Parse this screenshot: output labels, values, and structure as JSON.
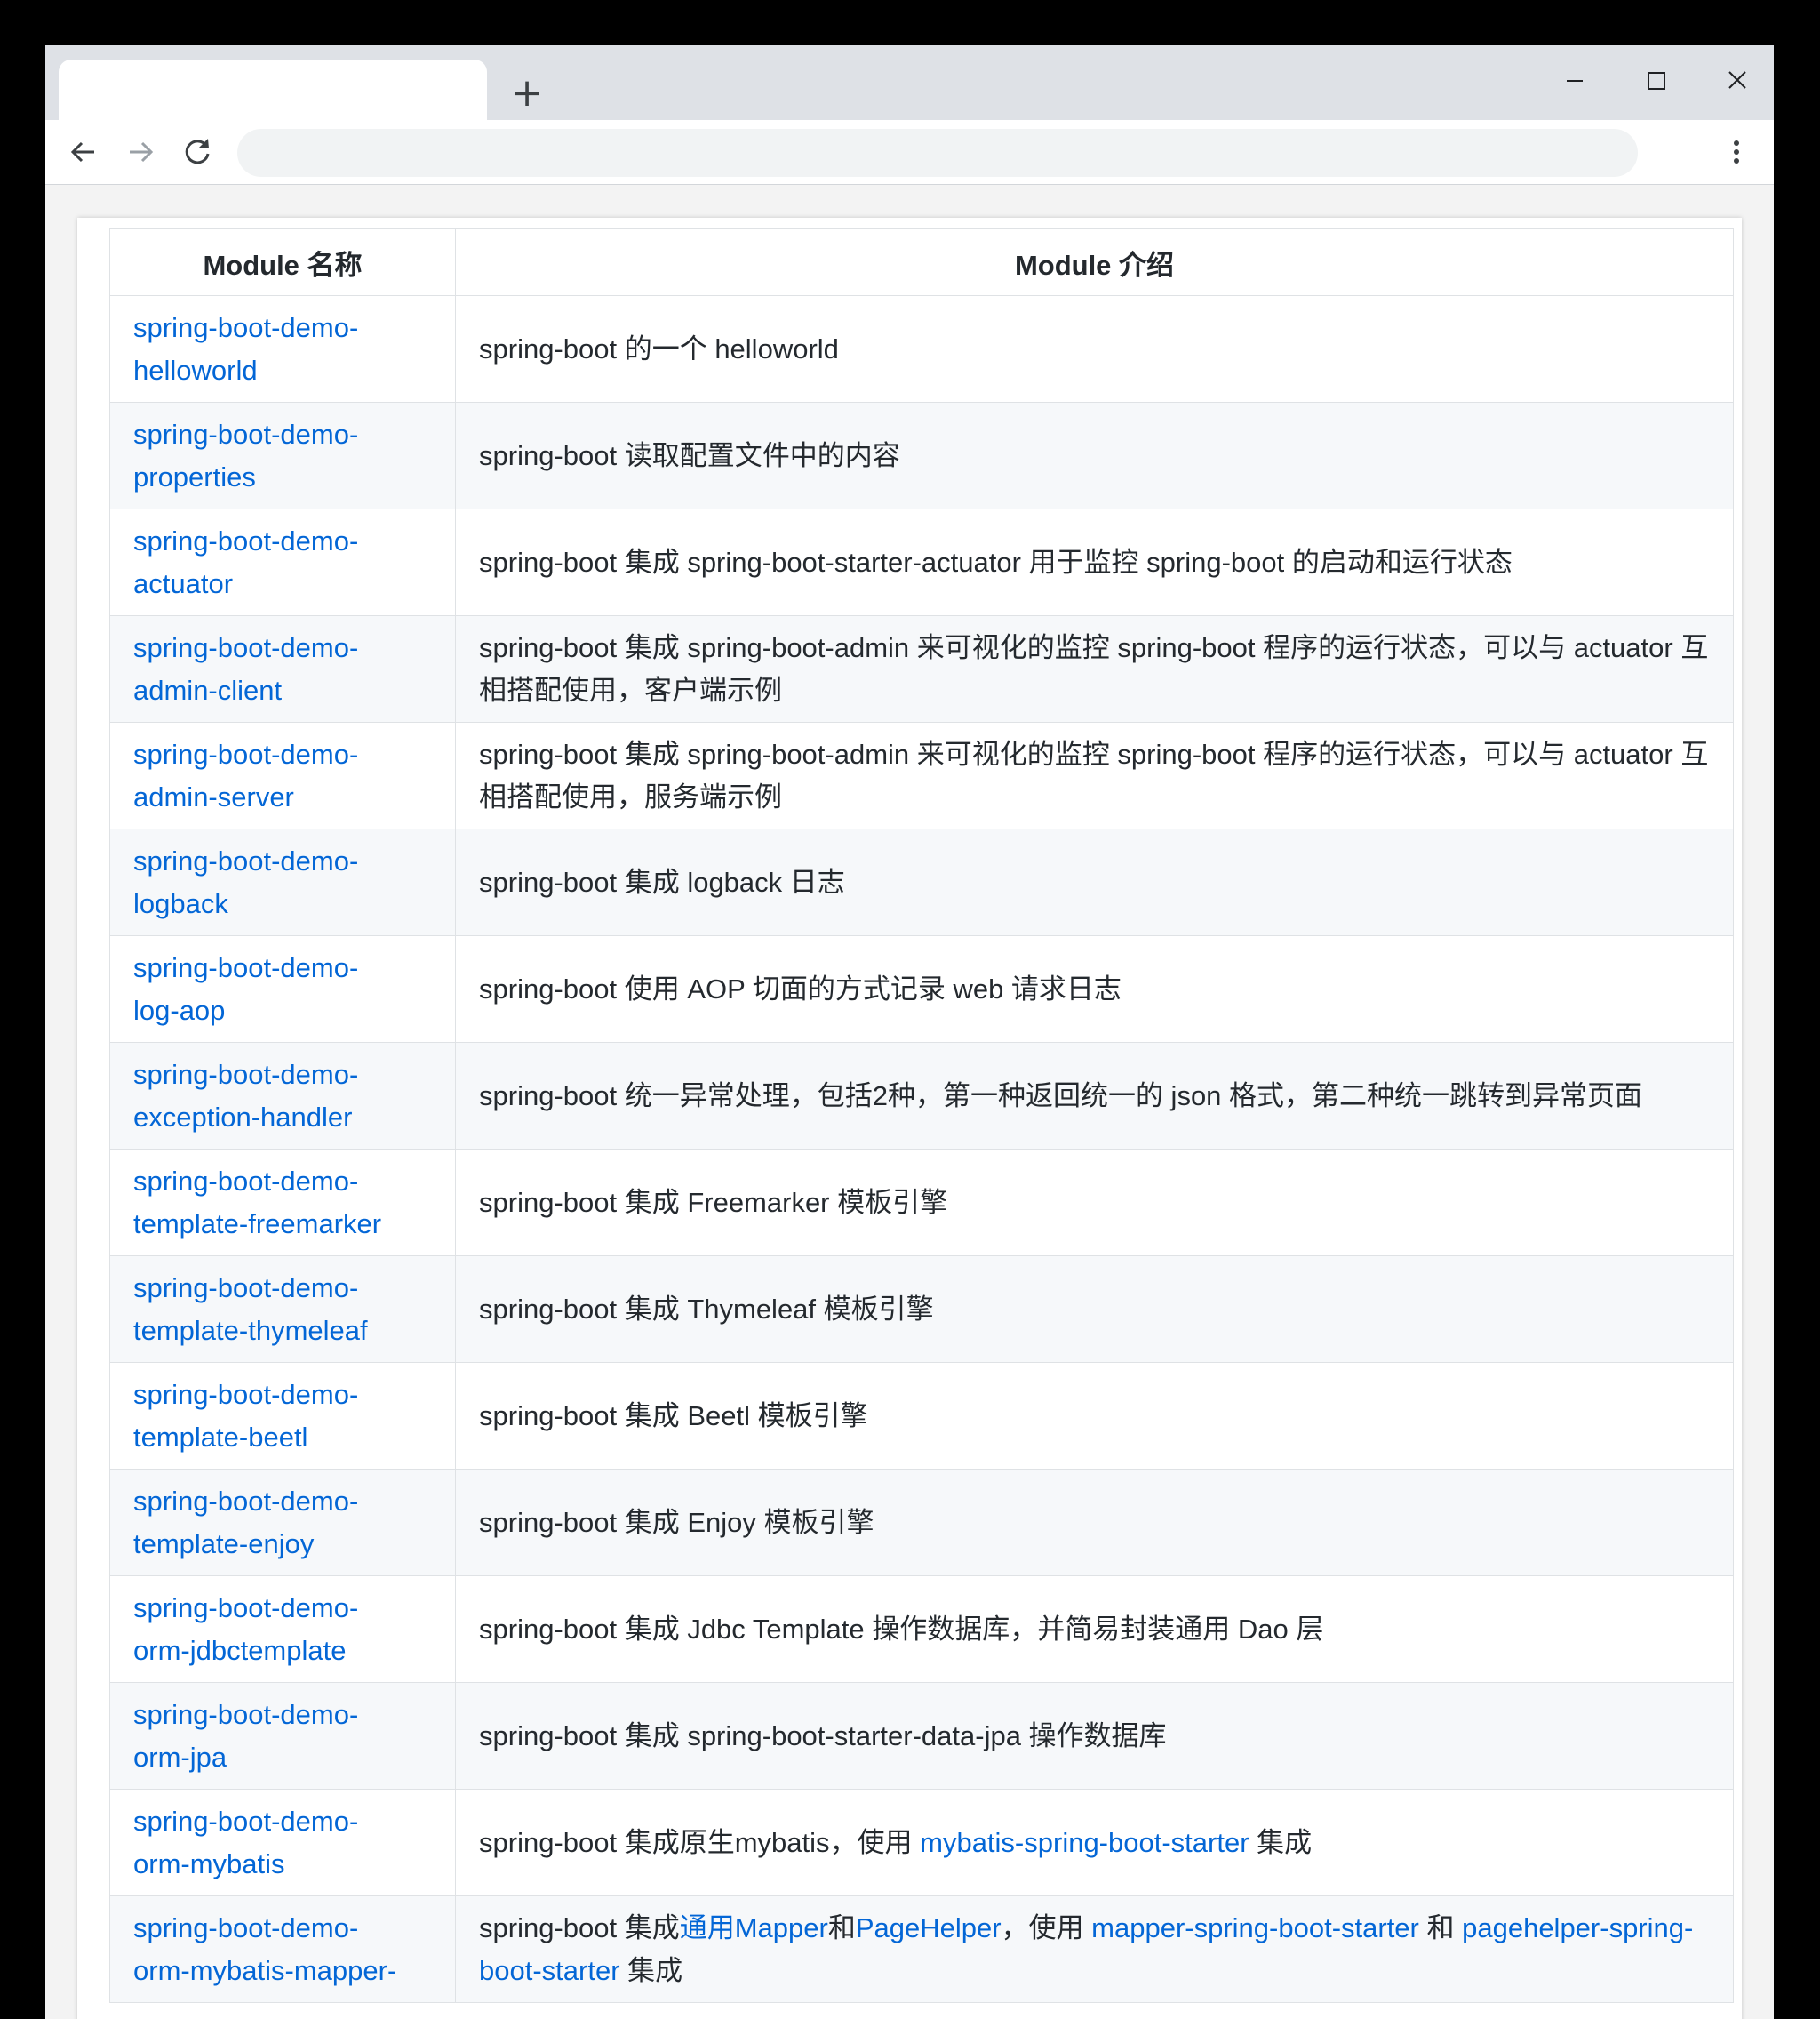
{
  "browser": {
    "tab_title": "",
    "new_tab_label": "+",
    "address_value": "",
    "icons": {
      "back": "arrow-left-icon",
      "forward": "arrow-right-icon",
      "reload": "reload-icon",
      "menu": "kebab-menu-icon",
      "minimize": "minimize-icon",
      "maximize": "maximize-icon",
      "close": "close-icon"
    }
  },
  "table": {
    "headers": [
      "Module 名称",
      "Module 介绍"
    ],
    "rows": [
      {
        "name": "spring-boot-demo-helloworld",
        "name_l1": "spring-boot-demo-",
        "name_l2": "helloworld",
        "desc": [
          {
            "t": "spring-boot 的一个 helloworld"
          }
        ]
      },
      {
        "name": "spring-boot-demo-properties",
        "name_l1": "spring-boot-demo-",
        "name_l2": "properties",
        "desc": [
          {
            "t": "spring-boot 读取配置文件中的内容"
          }
        ]
      },
      {
        "name": "spring-boot-demo-actuator",
        "name_l1": "spring-boot-demo-",
        "name_l2": "actuator",
        "desc": [
          {
            "t": "spring-boot 集成 spring-boot-starter-actuator 用于监控 spring-boot 的启动和运行状态"
          }
        ]
      },
      {
        "name": "spring-boot-demo-admin-client",
        "name_l1": "spring-boot-demo-",
        "name_l2": "admin-client",
        "desc": [
          {
            "t": "spring-boot 集成 spring-boot-admin 来可视化的监控 spring-boot 程序的运行状态，可以与 actuator 互相搭配使用，客户端示例"
          }
        ]
      },
      {
        "name": "spring-boot-demo-admin-server",
        "name_l1": "spring-boot-demo-",
        "name_l2": "admin-server",
        "desc": [
          {
            "t": "spring-boot 集成 spring-boot-admin 来可视化的监控 spring-boot 程序的运行状态，可以与 actuator 互相搭配使用，服务端示例"
          }
        ]
      },
      {
        "name": "spring-boot-demo-logback",
        "name_l1": "spring-boot-demo-",
        "name_l2": "logback",
        "desc": [
          {
            "t": "spring-boot 集成 logback 日志"
          }
        ]
      },
      {
        "name": "spring-boot-demo-log-aop",
        "name_l1": "spring-boot-demo-",
        "name_l2": "log-aop",
        "desc": [
          {
            "t": "spring-boot 使用 AOP 切面的方式记录 web 请求日志"
          }
        ]
      },
      {
        "name": "spring-boot-demo-exception-handler",
        "name_l1": "spring-boot-demo-",
        "name_l2": "exception-handler",
        "desc": [
          {
            "t": "spring-boot 统一异常处理，包括2种，第一种返回统一的 json 格式，第二种统一跳转到异常页面"
          }
        ]
      },
      {
        "name": "spring-boot-demo-template-freemarker",
        "name_l1": "spring-boot-demo-",
        "name_l2": "template-freemarker",
        "desc": [
          {
            "t": "spring-boot 集成 Freemarker 模板引擎"
          }
        ]
      },
      {
        "name": "spring-boot-demo-template-thymeleaf",
        "name_l1": "spring-boot-demo-",
        "name_l2": "template-thymeleaf",
        "desc": [
          {
            "t": "spring-boot 集成 Thymeleaf 模板引擎"
          }
        ]
      },
      {
        "name": "spring-boot-demo-template-beetl",
        "name_l1": "spring-boot-demo-",
        "name_l2": "template-beetl",
        "desc": [
          {
            "t": "spring-boot 集成 Beetl 模板引擎"
          }
        ]
      },
      {
        "name": "spring-boot-demo-template-enjoy",
        "name_l1": "spring-boot-demo-",
        "name_l2": "template-enjoy",
        "desc": [
          {
            "t": "spring-boot 集成 Enjoy 模板引擎"
          }
        ]
      },
      {
        "name": "spring-boot-demo-orm-jdbctemplate",
        "name_l1": "spring-boot-demo-",
        "name_l2": "orm-jdbctemplate",
        "desc": [
          {
            "t": "spring-boot 集成 Jdbc Template 操作数据库，并简易封装通用 Dao 层"
          }
        ]
      },
      {
        "name": "spring-boot-demo-orm-jpa",
        "name_l1": "spring-boot-demo-",
        "name_l2": "orm-jpa",
        "desc": [
          {
            "t": "spring-boot 集成 spring-boot-starter-data-jpa 操作数据库"
          }
        ]
      },
      {
        "name": "spring-boot-demo-orm-mybatis",
        "name_l1": "spring-boot-demo-",
        "name_l2": "orm-mybatis",
        "desc": [
          {
            "t": "spring-boot 集成原生mybatis，使用 "
          },
          {
            "t": "mybatis-spring-boot-starter",
            "link": true
          },
          {
            "t": " 集成"
          }
        ]
      },
      {
        "name": "spring-boot-demo-orm-mybatis-mapper-page",
        "name_l1": "spring-boot-demo-",
        "name_l2": "orm-mybatis-mapper-",
        "desc": [
          {
            "t": "spring-boot 集成"
          },
          {
            "t": "通用Mapper",
            "link": true
          },
          {
            "t": "和"
          },
          {
            "t": "PageHelper",
            "link": true
          },
          {
            "t": "，使用 "
          },
          {
            "t": "mapper-spring-boot-starter",
            "link": true
          },
          {
            "t": " 和 "
          },
          {
            "t": "pagehelper-spring-boot-starter",
            "link": true
          },
          {
            "t": " 集成"
          }
        ]
      }
    ]
  },
  "colors": {
    "link": "#0366d6",
    "text": "#24292e",
    "border": "#dfe2e5",
    "stripe": "#f6f8fa",
    "tabstrip": "#dee1e6"
  }
}
